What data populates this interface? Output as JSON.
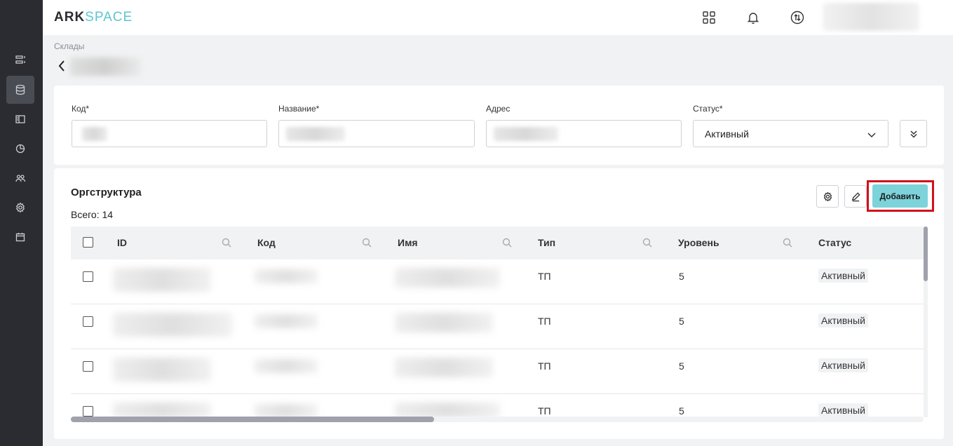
{
  "header": {
    "logo_ark": "ARK",
    "logo_space": "SPACE",
    "icons": [
      "apps-grid-icon",
      "bell-icon",
      "sync-icon"
    ]
  },
  "sidebar": {
    "items": [
      {
        "name": "list-icon",
        "active": false
      },
      {
        "name": "database-icon",
        "active": true
      },
      {
        "name": "layout-icon",
        "active": false
      },
      {
        "name": "chart-pie-icon",
        "active": false
      },
      {
        "name": "users-icon",
        "active": false
      },
      {
        "name": "settings-icon",
        "active": false
      },
      {
        "name": "calendar-icon",
        "active": false
      }
    ]
  },
  "breadcrumb": "Склады",
  "form": {
    "code_label": "Код*",
    "name_label": "Название*",
    "address_label": "Адрес",
    "status_label": "Статус*",
    "status_value": "Активный"
  },
  "org": {
    "title": "Оргструктура",
    "total": "Всего: 14",
    "add_label": "Добавить",
    "columns": [
      "ID",
      "Код",
      "Имя",
      "Тип",
      "Уровень",
      "Статус"
    ],
    "rows": [
      {
        "type": "ТП",
        "level": "5",
        "status": "Активный"
      },
      {
        "type": "ТП",
        "level": "5",
        "status": "Активный"
      },
      {
        "type": "ТП",
        "level": "5",
        "status": "Активный"
      },
      {
        "type": "ТП",
        "level": "5",
        "status": "Активный"
      }
    ]
  },
  "colors": {
    "accent": "#7dd3da",
    "highlight": "#d0121b",
    "sidebar_bg": "#2b2c31"
  }
}
